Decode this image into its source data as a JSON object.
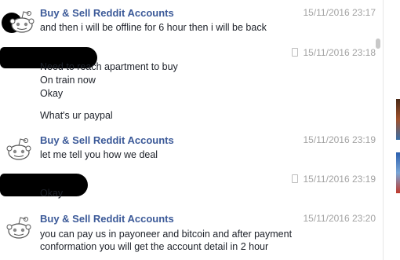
{
  "messages": [
    {
      "sender": "Buy & Sell Reddit Accounts",
      "time": "15/11/2016 23:17",
      "lines": [
        "and then i will be offline for 6 hour then i will be back"
      ]
    },
    {
      "sender": "",
      "time": "15/11/2016 23:18",
      "lines": [
        "Need to reach apartment to buy",
        "On train now",
        "Okay",
        "What's ur paypal"
      ]
    },
    {
      "sender": "Buy & Sell Reddit Accounts",
      "time": "15/11/2016 23:19",
      "lines": [
        "let me tell you how we deal"
      ]
    },
    {
      "sender": "",
      "time": "15/11/2016 23:19",
      "lines": [
        "Okay"
      ]
    },
    {
      "sender": "Buy & Sell Reddit Accounts",
      "time": "15/11/2016 23:20",
      "lines": [
        "you can pay us in payoneer and bitcoin and after payment",
        "conformation you will get the account detail in 2 hour"
      ]
    }
  ],
  "icons": {
    "avatar": "reddit-alien-icon",
    "mobile": "mobile-phone-icon"
  },
  "colors": {
    "sender": "#3b5998",
    "time": "#a3a3a3",
    "text": "#1d2129",
    "redaction": "#000000"
  }
}
